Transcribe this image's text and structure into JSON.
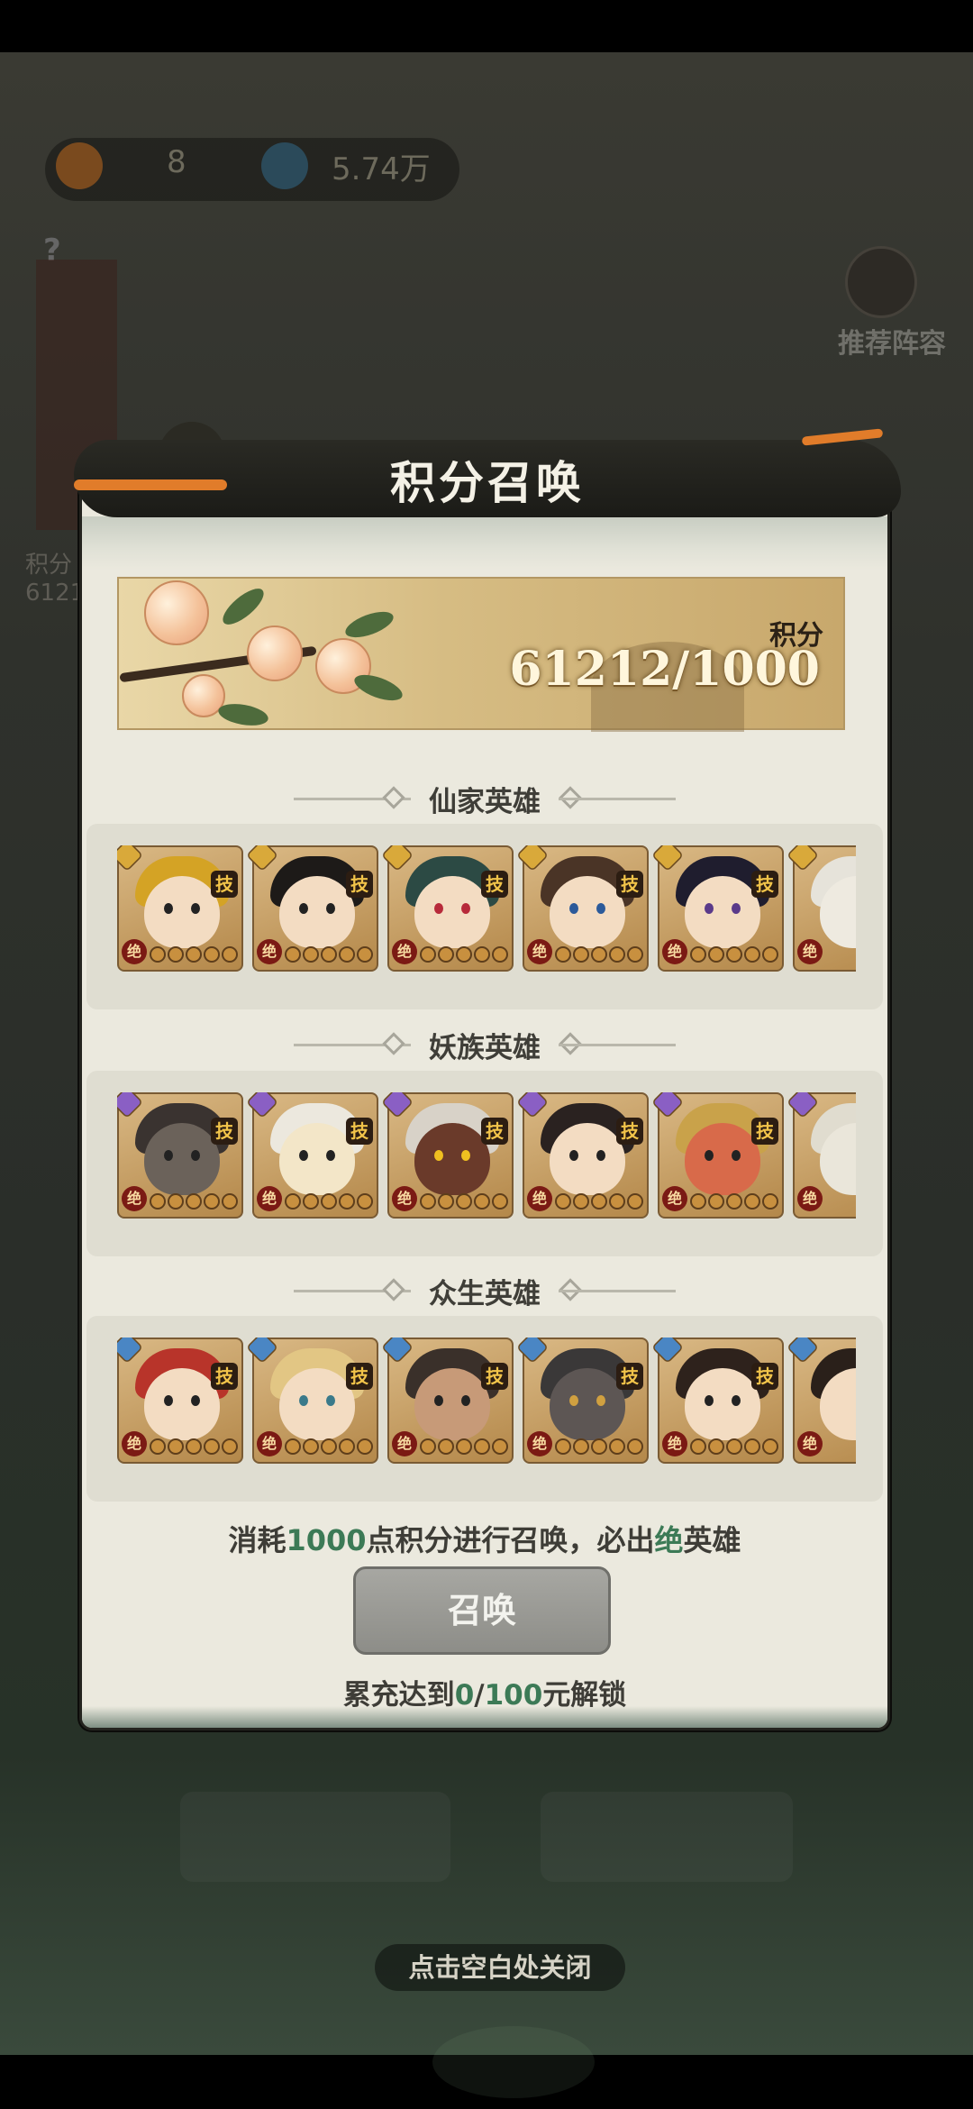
{
  "background": {
    "resource_1_value": "8",
    "resource_2_value": "5.74万",
    "question_mark": "?",
    "recommend_label": "推荐阵容",
    "side_label": "积分",
    "side_value": "6121"
  },
  "dialog": {
    "title": "积分召唤",
    "score": {
      "label": "积分",
      "value": "61212/1000"
    },
    "sections": [
      {
        "title": "仙家英雄",
        "badge_color": "#d9a93a",
        "hero_count_visible": 6
      },
      {
        "title": "妖族英雄",
        "badge_color": "#8a5fc4",
        "hero_count_visible": 6
      },
      {
        "title": "众生英雄",
        "badge_color": "#4a86c4",
        "hero_count_visible": 6
      }
    ],
    "hero_skill_badge": "技",
    "hero_jue_badge": "绝",
    "message": {
      "prefix": "消耗",
      "cost": "1000",
      "middle": "点积分进行召唤，必出",
      "rarity": "绝",
      "suffix": "英雄"
    },
    "summon_button": "召唤",
    "unlock": {
      "prefix": "累充达到",
      "current": "0",
      "sep": "/",
      "target": "100",
      "suffix": "元解锁"
    }
  },
  "close_hint": "点击空白处关闭",
  "colors": {
    "accent_green": "#3c7a56",
    "button_disabled": "#9b9b96",
    "panel_bg": "#ebe9de"
  }
}
